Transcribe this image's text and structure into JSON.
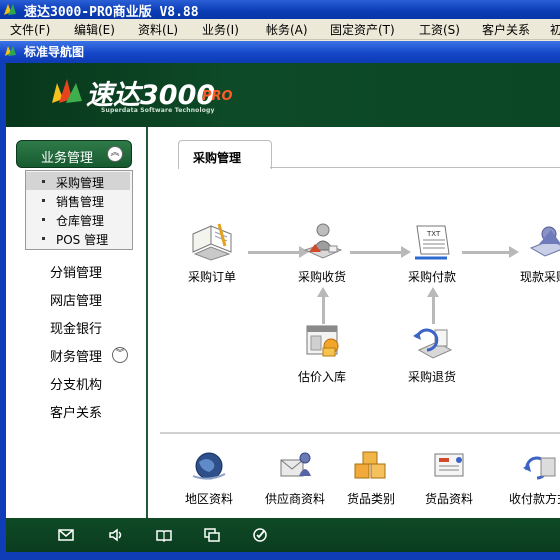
{
  "window": {
    "title": "速达3000-PRO商业版 V8.88"
  },
  "menubar": [
    {
      "label": "文件(F)"
    },
    {
      "label": "编辑(E)"
    },
    {
      "label": "资料(L)"
    },
    {
      "label": "业务(I)"
    },
    {
      "label": "帐务(A)"
    },
    {
      "label": "固定资产(T)"
    },
    {
      "label": "工资(S)"
    },
    {
      "label": "客户关系"
    },
    {
      "label": "初"
    }
  ],
  "inner_window": {
    "title": "标准导航图"
  },
  "banner": {
    "brand": "速达3000",
    "suffix": "PRO",
    "tagline": "Superdata Software Technology"
  },
  "sidebar": {
    "group": "业务管理",
    "sub_items": [
      {
        "label": "采购管理",
        "selected": true
      },
      {
        "label": "销售管理"
      },
      {
        "label": "仓库管理"
      },
      {
        "label": "POS 管理"
      }
    ],
    "items": [
      {
        "label": "分销管理"
      },
      {
        "label": "网店管理"
      },
      {
        "label": "现金银行"
      },
      {
        "label": "财务管理"
      },
      {
        "label": "分支机构"
      },
      {
        "label": "客户关系"
      }
    ]
  },
  "tab": {
    "label": "采购管理"
  },
  "flow": {
    "nodes": [
      {
        "label": "采购订单",
        "icon": "order-book-icon"
      },
      {
        "label": "采购收货",
        "icon": "receive-goods-icon"
      },
      {
        "label": "采购付款",
        "icon": "payment-icon"
      },
      {
        "label": "现款采购",
        "icon": "cash-purchase-icon"
      },
      {
        "label": "估价入库",
        "icon": "estimate-storage-icon"
      },
      {
        "label": "采购退货",
        "icon": "return-goods-icon"
      }
    ]
  },
  "quick": [
    {
      "label": "地区资料",
      "icon": "globe-icon"
    },
    {
      "label": "供应商资料",
      "icon": "supplier-icon"
    },
    {
      "label": "货品类别",
      "icon": "boxes-icon"
    },
    {
      "label": "货品资料",
      "icon": "goods-info-icon"
    },
    {
      "label": "收付款方式",
      "icon": "payment-method-icon"
    }
  ],
  "colors": {
    "banner_green": "#0d4a27",
    "title_blue": "#0a3cb4",
    "brand_orange": "#ff5a2a"
  }
}
